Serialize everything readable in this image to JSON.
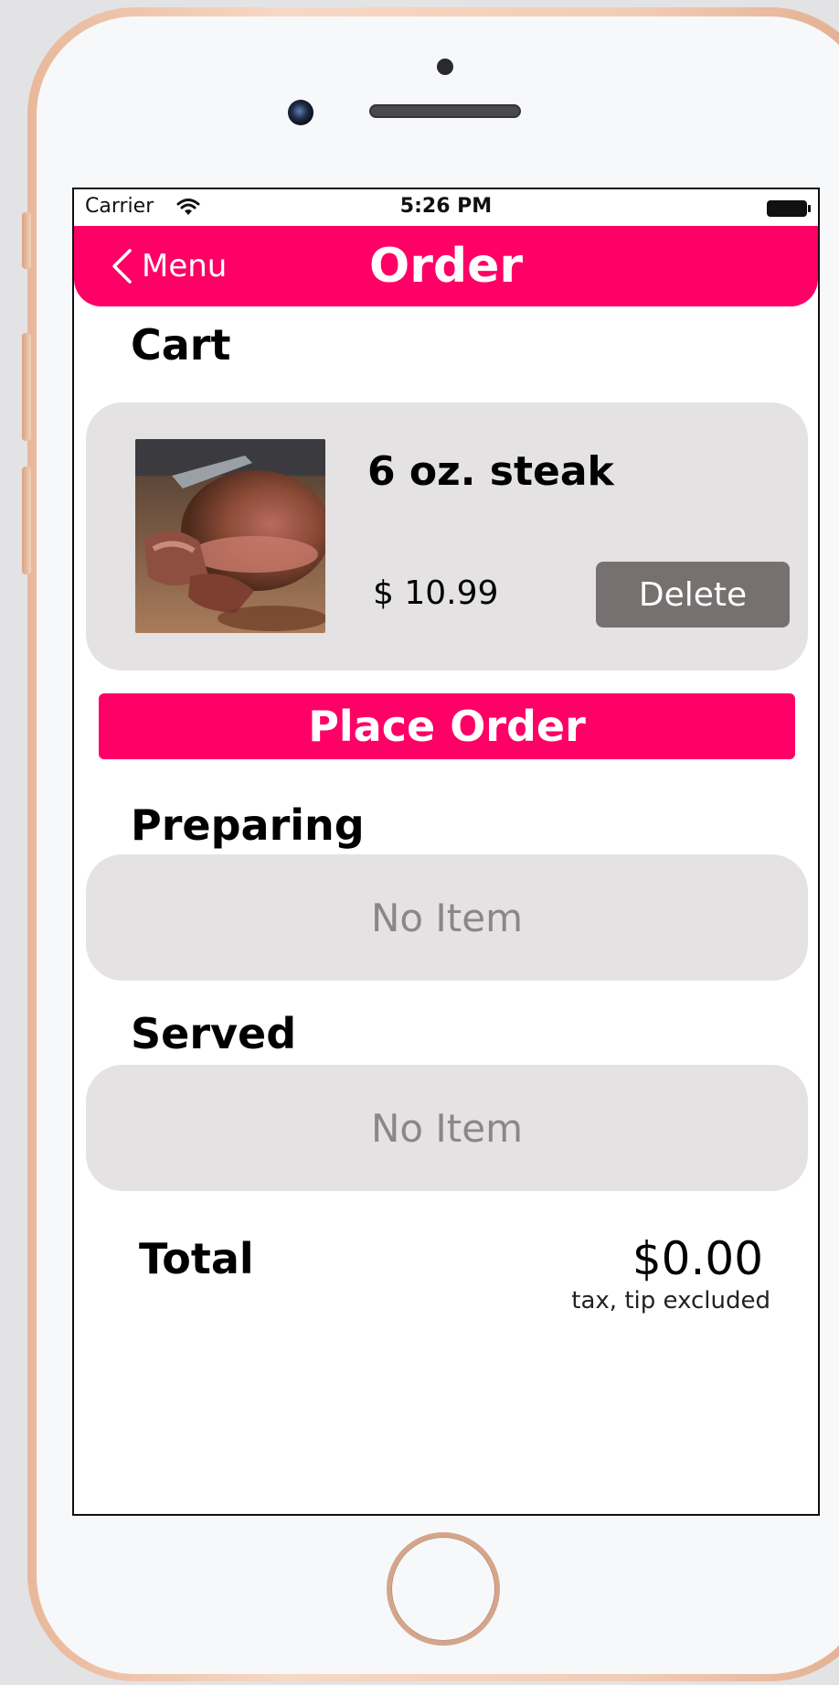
{
  "status_bar": {
    "carrier": "Carrier",
    "time": "5:26 PM"
  },
  "nav": {
    "back_label": "Menu",
    "title": "Order"
  },
  "cart": {
    "title": "Cart",
    "item": {
      "name": "6 oz. steak",
      "price": "$ 10.99",
      "delete_label": "Delete"
    }
  },
  "place_order_label": "Place Order",
  "preparing": {
    "title": "Preparing",
    "empty_text": "No Item"
  },
  "served": {
    "title": "Served",
    "empty_text": "No Item"
  },
  "total": {
    "label": "Total",
    "value": "$0.00",
    "note": "tax, tip excluded"
  },
  "colors": {
    "accent": "#fe0066",
    "card_background": "#e4e2e3",
    "delete_button": "#767170"
  },
  "icons": [
    "wifi-icon",
    "battery-icon",
    "chevron-left-icon"
  ]
}
